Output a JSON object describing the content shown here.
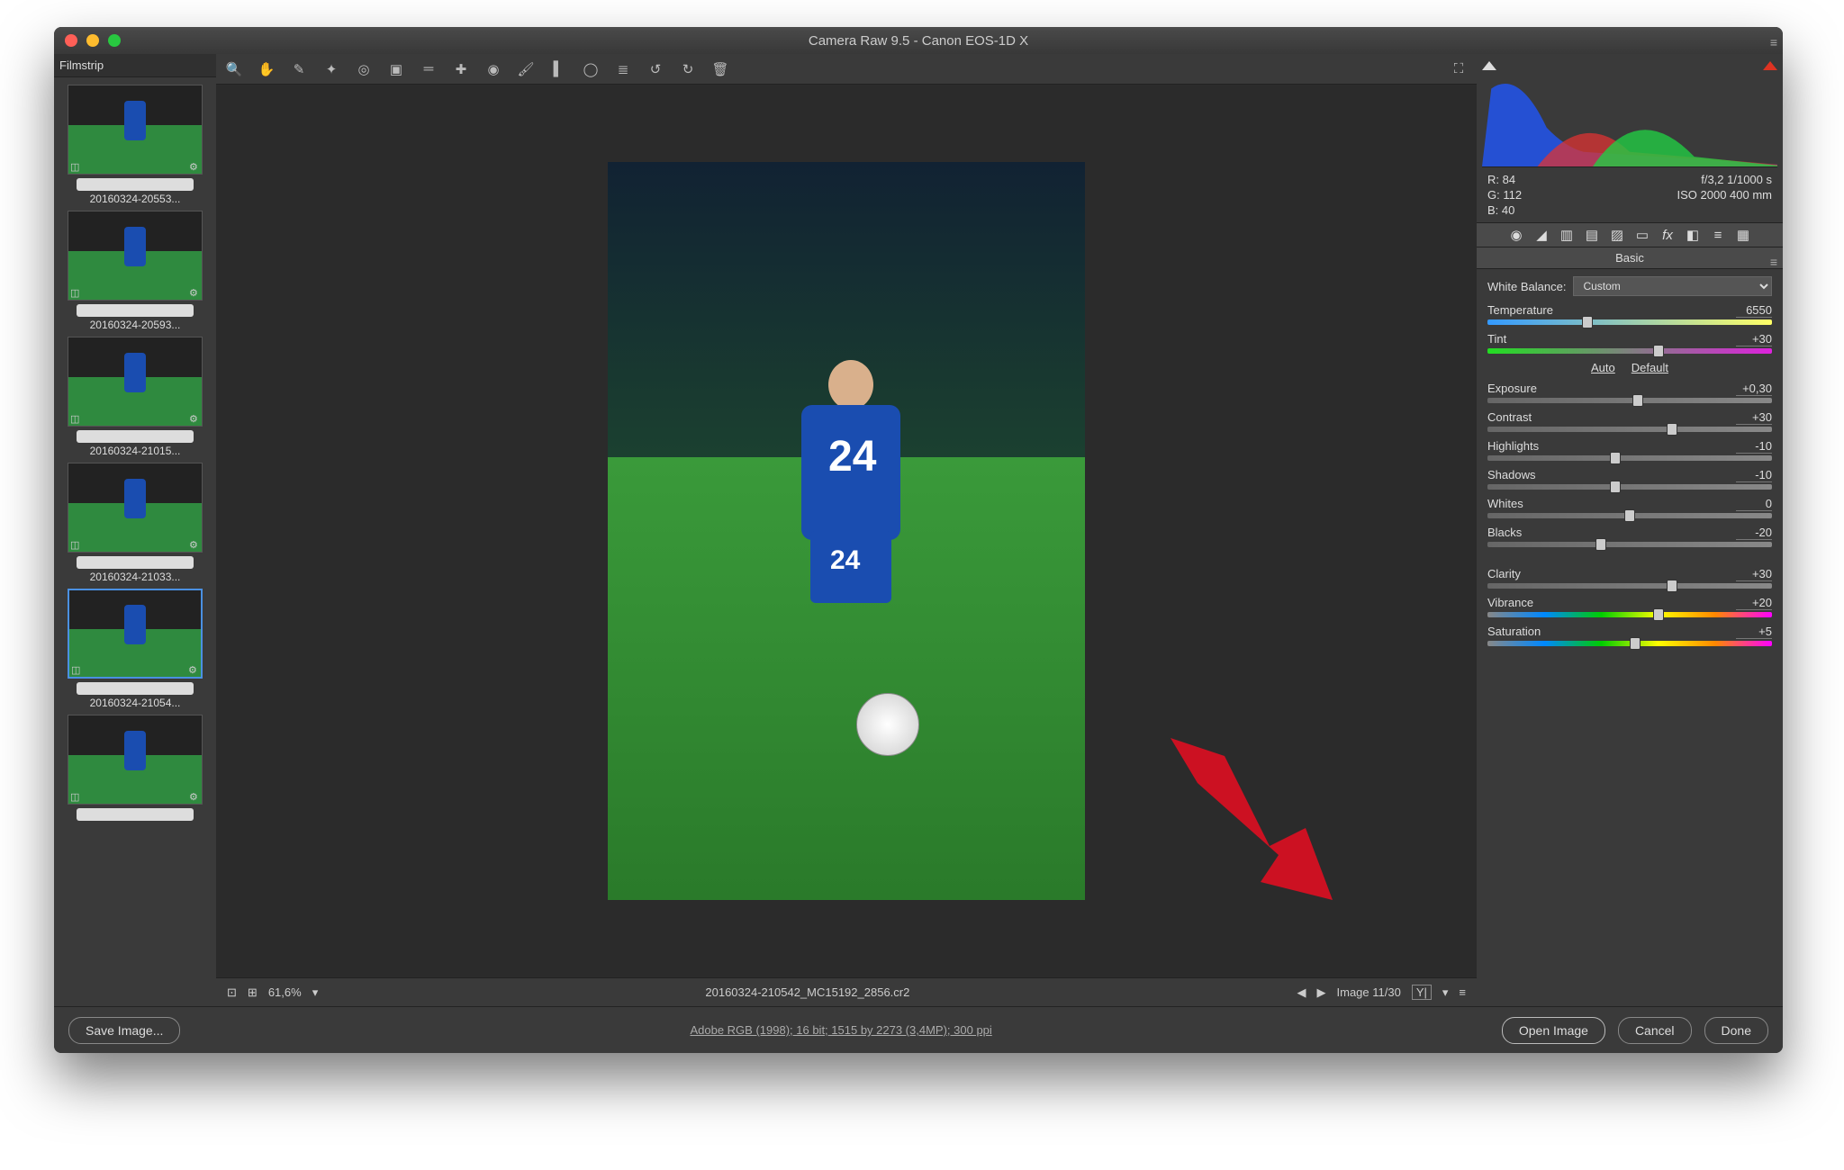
{
  "window": {
    "title": "Camera Raw 9.5  -  Canon EOS-1D X"
  },
  "filmstrip": {
    "title": "Filmstrip",
    "thumbs": [
      {
        "caption": "20160324-20553..."
      },
      {
        "caption": "20160324-20593..."
      },
      {
        "caption": "20160324-21015..."
      },
      {
        "caption": "20160324-21033..."
      },
      {
        "caption": "20160324-21054...",
        "selected": true
      },
      {
        "caption": ""
      }
    ]
  },
  "toolbar_icons": [
    "zoom",
    "hand",
    "white-balance",
    "color-sampler",
    "target-adjust",
    "crop",
    "straighten",
    "spot-removal",
    "red-eye",
    "brush",
    "grad-filter",
    "radial-filter",
    "list",
    "rotate-ccw",
    "rotate-cw",
    "trash"
  ],
  "preview": {
    "jersey_number": "24"
  },
  "status": {
    "zoom": "61,6%",
    "filename": "20160324-210542_MC15192_2856.cr2",
    "counter": "Image 11/30"
  },
  "rgb": {
    "r_label": "R:",
    "r": "84",
    "g_label": "G:",
    "g": "112",
    "b_label": "B:",
    "b": "40"
  },
  "exif": {
    "aperture_speed": "f/3,2   1/1000 s",
    "iso_focal": "ISO 2000   400 mm"
  },
  "panel": {
    "title": "Basic",
    "wb_label": "White Balance:",
    "wb_value": "Custom",
    "auto": "Auto",
    "default": "Default",
    "sliders": [
      {
        "name": "Temperature",
        "value": "6550",
        "pos": 35,
        "track": "temp"
      },
      {
        "name": "Tint",
        "value": "+30",
        "pos": 60,
        "track": "tint"
      },
      {
        "name": "Exposure",
        "value": "+0,30",
        "pos": 53
      },
      {
        "name": "Contrast",
        "value": "+30",
        "pos": 65
      },
      {
        "name": "Highlights",
        "value": "-10",
        "pos": 45
      },
      {
        "name": "Shadows",
        "value": "-10",
        "pos": 45
      },
      {
        "name": "Whites",
        "value": "0",
        "pos": 50
      },
      {
        "name": "Blacks",
        "value": "-20",
        "pos": 40
      },
      {
        "name": "Clarity",
        "value": "+30",
        "pos": 65
      },
      {
        "name": "Vibrance",
        "value": "+20",
        "pos": 60,
        "track": "vib"
      },
      {
        "name": "Saturation",
        "value": "+5",
        "pos": 52,
        "track": "sat"
      }
    ]
  },
  "footer": {
    "save": "Save Image...",
    "workflow": "Adobe RGB (1998); 16 bit; 1515 by 2273 (3,4MP); 300 ppi",
    "open": "Open Image",
    "cancel": "Cancel",
    "done": "Done"
  }
}
